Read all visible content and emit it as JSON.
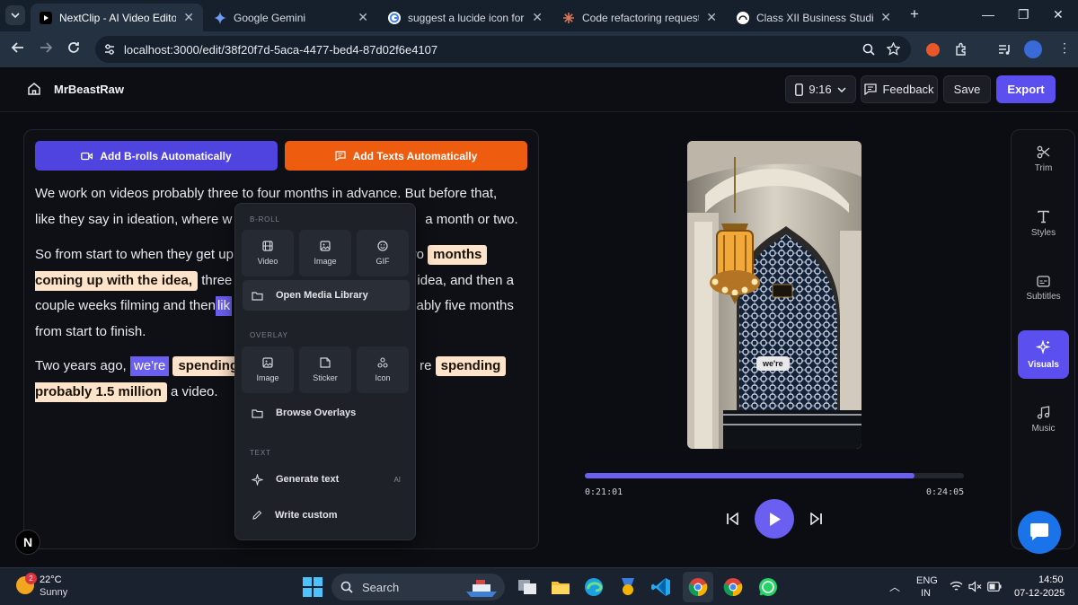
{
  "browser": {
    "tabs": [
      {
        "title": "NextClip - AI Video Editor fo",
        "active": true
      },
      {
        "title": "Google Gemini",
        "active": false
      },
      {
        "title": "suggest a lucide icon for Op",
        "active": false
      },
      {
        "title": "Code refactoring request - C",
        "active": false
      },
      {
        "title": "Class XII Business Studies M",
        "active": false
      }
    ],
    "url": "localhost:3000/edit/38f20f7d-5aca-4477-bed4-87d02f6e4107"
  },
  "app": {
    "project_name": "MrBeastRaw",
    "aspect_ratio": "9:16",
    "feedback_label": "Feedback",
    "save_label": "Save",
    "export_label": "Export"
  },
  "editor": {
    "add_brolls_label": "Add B-rolls Automatically",
    "add_texts_label": "Add Texts Automatically",
    "p1": {
      "a": "We work on videos probably three to four months in advance. But before that,",
      "b": "like they say in ideation, where w",
      "c": "a month or two."
    },
    "p2": {
      "a": "So from start to when they get up",
      "b": "to two",
      "hl1": "months",
      "hl2": "coming up with the idea,",
      "c": "three",
      "d": "idea, and then a",
      "e": "couple weeks filming and then",
      "sel": "lik",
      "f": "bably five months",
      "g": "from start to finish."
    },
    "p3": {
      "a": "Two years ago,",
      "sel": "we're",
      "hl1": "spending",
      "b": "re",
      "hl2": "spending",
      "hl3": "probably 1.5 million",
      "c": "a video."
    }
  },
  "menu": {
    "broll_heading": "B-ROLL",
    "broll_items": [
      "Video",
      "Image",
      "GIF"
    ],
    "open_media_library": "Open Media Library",
    "overlay_heading": "OVERLAY",
    "overlay_items": [
      "Image",
      "Sticker",
      "Icon"
    ],
    "browse_overlays": "Browse Overlays",
    "text_heading": "TEXT",
    "generate_text": "Generate text",
    "ai_badge": "AI",
    "write_custom": "Write custom"
  },
  "player": {
    "caption": "we're",
    "current_time": "0:21:01",
    "total_time": "0:24:05",
    "progress": 0.87
  },
  "right_panel": {
    "items": [
      "Trim",
      "Styles",
      "Subtitles",
      "Visuals",
      "Music"
    ],
    "active": "Visuals"
  },
  "taskbar": {
    "weather_temp": "22°C",
    "weather_text": "Sunny",
    "weather_badge": "2",
    "search_placeholder": "Search",
    "lang1": "ENG",
    "lang2": "IN",
    "time": "14:50",
    "date": "07-12-2025"
  },
  "colors": {
    "accent": "#5b4ff0",
    "orange": "#f05f12",
    "highlight": "#fde3c9"
  }
}
